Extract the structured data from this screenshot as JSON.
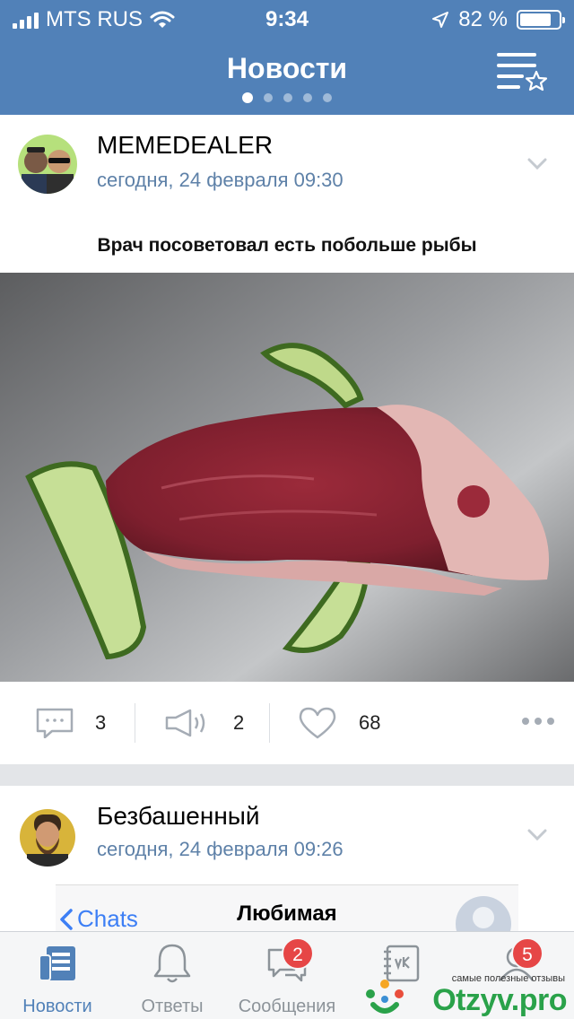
{
  "status_bar": {
    "carrier": "MTS RUS",
    "time": "9:34",
    "battery": "82 %",
    "battery_level": 0.82
  },
  "header": {
    "title": "Новости",
    "page_dots": 5,
    "active_dot": 0
  },
  "posts": [
    {
      "author": "MEMEDEALER",
      "date": "сегодня, 24 февраля 09:30",
      "caption": "Врач посоветовал есть побольше рыбы",
      "comments": "3",
      "reposts": "2",
      "likes": "68"
    },
    {
      "author": "Безбашенный",
      "date": "сегодня, 24 февраля 09:26",
      "embedded": {
        "back_label": "Chats",
        "contact_name": "Любимая"
      }
    }
  ],
  "tabbar": {
    "tabs": [
      {
        "label": "Новости",
        "active": true
      },
      {
        "label": "Ответы"
      },
      {
        "label": "Сообщения",
        "badge": "2"
      },
      {
        "label": ""
      },
      {
        "label": "",
        "badge": "5"
      }
    ]
  },
  "watermark": {
    "small": "самые полезные отзывы",
    "big": "Otzyv.pro"
  },
  "colors": {
    "header": "#5181b8",
    "link_date": "#5e81a8",
    "badge": "#e64646",
    "active_tab": "#5181b8",
    "inactive_tab": "#8c9399"
  }
}
